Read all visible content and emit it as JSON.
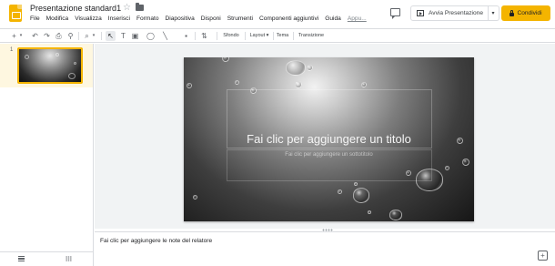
{
  "header": {
    "doc_title": "Presentazione standard1",
    "menu": [
      "File",
      "Modifica",
      "Visualizza",
      "Inserisci",
      "Formato",
      "Diapositiva",
      "Disponi",
      "Strumenti",
      "Componenti aggiuntivi",
      "Guida",
      "Appu..."
    ],
    "present_label": "Avvia Presentazione",
    "present_caret": "▾",
    "share_label": "Condividi"
  },
  "toolbar": {
    "add": "+",
    "add_caret": "▾",
    "undo": "↶",
    "redo": "↷",
    "print": "⎙",
    "paint": "⚲",
    "zoom": "⌕",
    "zoom_caret": "▾",
    "select": "↖",
    "textbox": "T",
    "image": "▣",
    "shape": "◯",
    "line": "╲",
    "comment": "▪",
    "format_options": "⇅",
    "sfondo": "Sfondo",
    "layout": "Layout ▾",
    "tema": "Tema",
    "transizione": "Transizione"
  },
  "filmstrip": {
    "slide_number": "1"
  },
  "slide": {
    "title_placeholder": "Fai clic per aggiungere un titolo",
    "subtitle_placeholder": "Fai clic per aggiungere un sottotitolo"
  },
  "notes": {
    "placeholder": "Fai clic per aggiungere le note del relatore"
  },
  "colors": {
    "accent": "#f4b400",
    "selection_bg": "#fef7e0",
    "canvas_bg": "#f1f3f4"
  },
  "icons": [
    "slides-logo-icon",
    "star-icon",
    "folder-icon",
    "comment-icon",
    "present-icon",
    "lock-icon",
    "explore-icon"
  ]
}
